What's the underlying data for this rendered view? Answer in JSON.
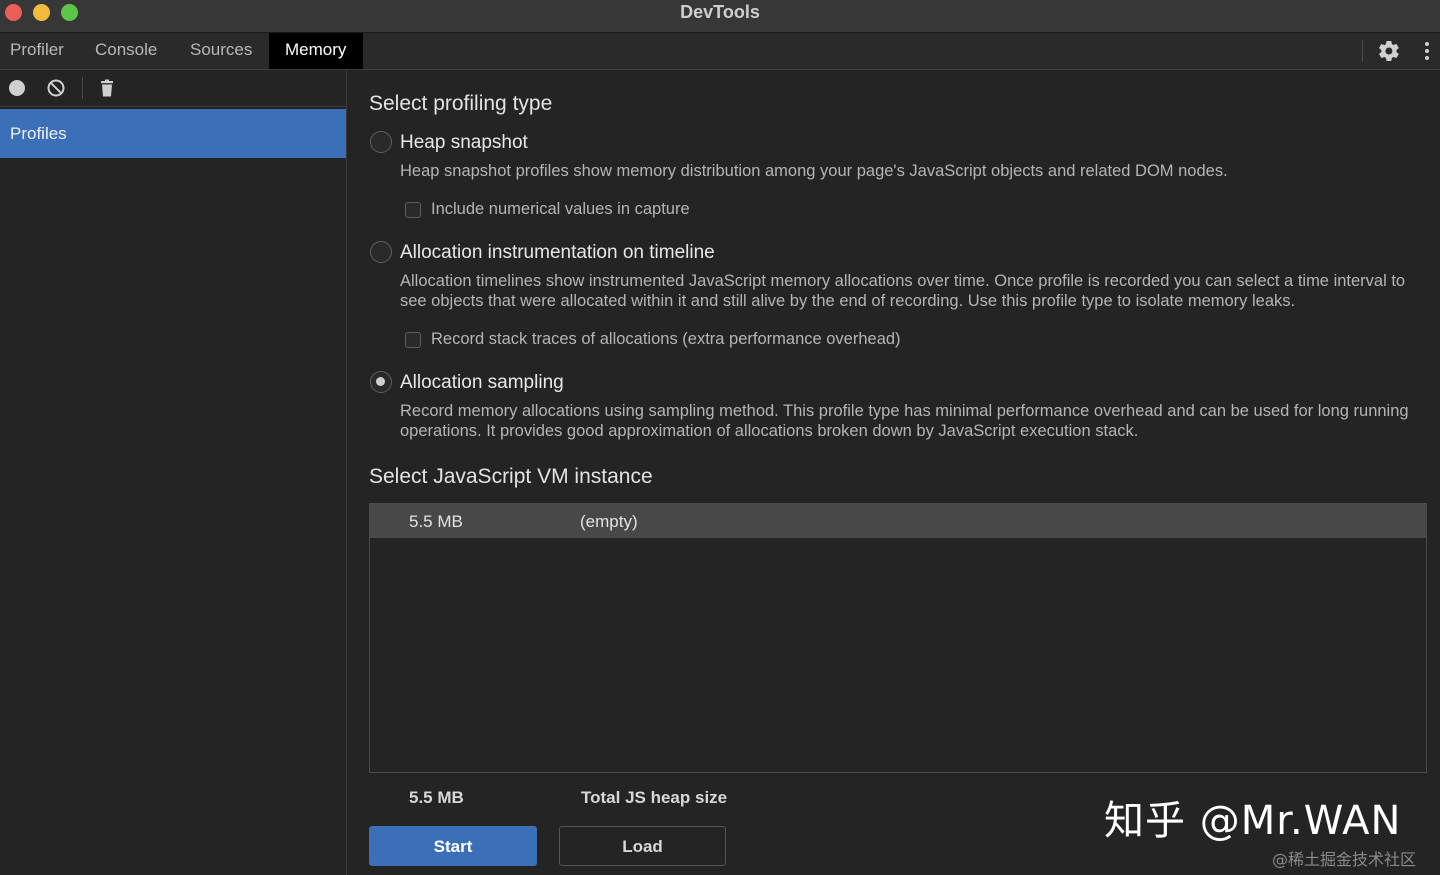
{
  "window": {
    "title": "DevTools"
  },
  "tabs": [
    {
      "label": "Profiler"
    },
    {
      "label": "Console"
    },
    {
      "label": "Sources"
    },
    {
      "label": "Memory",
      "active": true
    }
  ],
  "sidebar": {
    "items": [
      {
        "label": "Profiles",
        "selected": true
      }
    ]
  },
  "main": {
    "profiling_type_heading": "Select profiling type",
    "options": [
      {
        "label": "Heap snapshot",
        "checked": false,
        "description": "Heap snapshot profiles show memory distribution among your page's JavaScript objects and related DOM nodes.",
        "checkbox_label": "Include numerical values in capture"
      },
      {
        "label": "Allocation instrumentation on timeline",
        "checked": false,
        "description": "Allocation timelines show instrumented JavaScript memory allocations over time. Once profile is recorded you can select a time interval to see objects that were allocated within it and still alive by the end of recording. Use this profile type to isolate memory leaks.",
        "checkbox_label": "Record stack traces of allocations (extra performance overhead)"
      },
      {
        "label": "Allocation sampling",
        "checked": true,
        "description": "Record memory allocations using sampling method. This profile type has minimal performance overhead and can be used for long running operations. It provides good approximation of allocations broken down by JavaScript execution stack."
      }
    ],
    "vm_heading": "Select JavaScript VM instance",
    "vm_instances": [
      {
        "size": "5.5 MB",
        "name": "(empty)"
      }
    ],
    "summary": {
      "size": "5.5 MB",
      "label": "Total JS heap size"
    },
    "start_button": "Start",
    "load_button": "Load"
  },
  "watermark": {
    "main": "知乎 @Mr.WAN",
    "sub": "@稀土掘金技术社区"
  },
  "colors": {
    "accent": "#3b6fb7",
    "background": "#242424"
  }
}
